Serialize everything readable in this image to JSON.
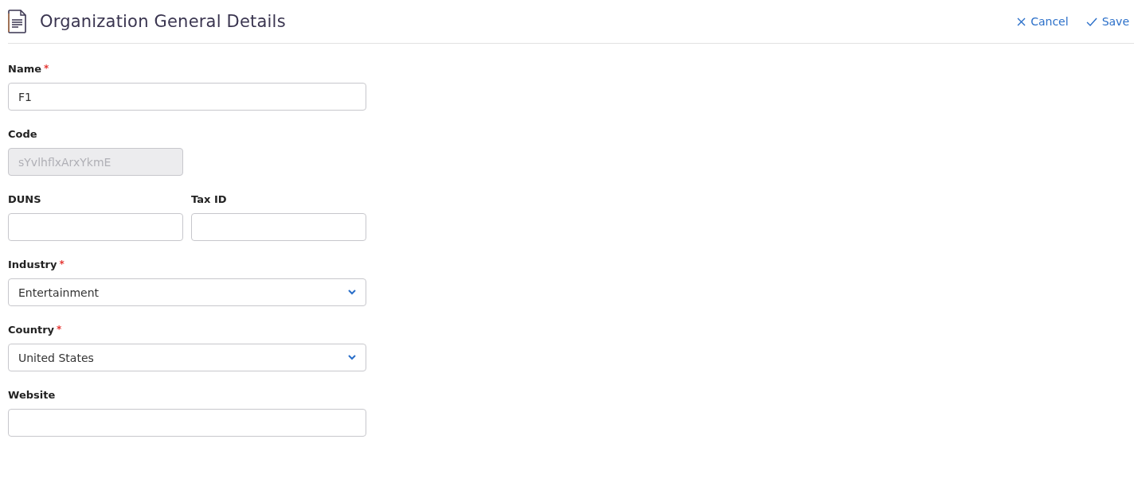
{
  "header": {
    "title": "Organization General Details",
    "actions": [
      {
        "label": "Cancel",
        "kind": "cancel"
      },
      {
        "label": "Save",
        "kind": "save"
      }
    ]
  },
  "rows": [
    [
      {
        "label": "Name",
        "required_mark": "*",
        "kind": "text",
        "value": "F1",
        "disabled": false
      }
    ],
    [
      {
        "label": "Code",
        "kind": "short_text",
        "value": "sYvlhflxArxYkmE",
        "disabled": true
      }
    ],
    [
      {
        "label": "DUNS",
        "kind": "short_text",
        "disabled": false
      },
      {
        "label": "Tax ID",
        "kind": "short_text",
        "disabled": false
      }
    ],
    [
      {
        "label": "Industry",
        "required_mark": "*",
        "kind": "select",
        "value": "Entertainment",
        "disabled": false
      }
    ],
    [
      {
        "label": "Country",
        "required_mark": "*",
        "kind": "select",
        "value": "United States",
        "disabled": false
      }
    ],
    [
      {
        "label": "Website",
        "kind": "text",
        "disabled": false
      }
    ]
  ]
}
